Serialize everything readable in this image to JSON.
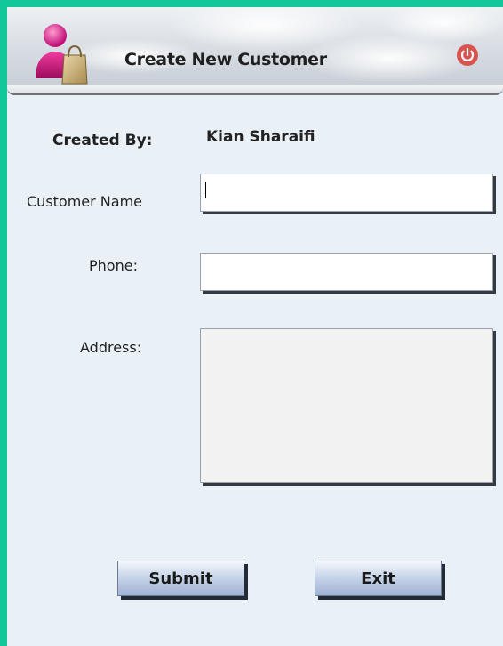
{
  "header": {
    "title": "Create New Customer",
    "logo_icon": "customer-shopping-bag-icon",
    "power_icon": "power-icon",
    "power_color": "#d9534f"
  },
  "form": {
    "created_by_label": "Created By:",
    "created_by_value": "Kian Sharaifi",
    "customer_name_label": "Customer Name",
    "customer_name_value": "",
    "phone_label": "Phone:",
    "phone_value": "",
    "address_label": "Address:",
    "address_value": ""
  },
  "buttons": {
    "submit_label": "Submit",
    "exit_label": "Exit"
  },
  "colors": {
    "frame": "#12c79a",
    "background": "#e9f0f6"
  }
}
